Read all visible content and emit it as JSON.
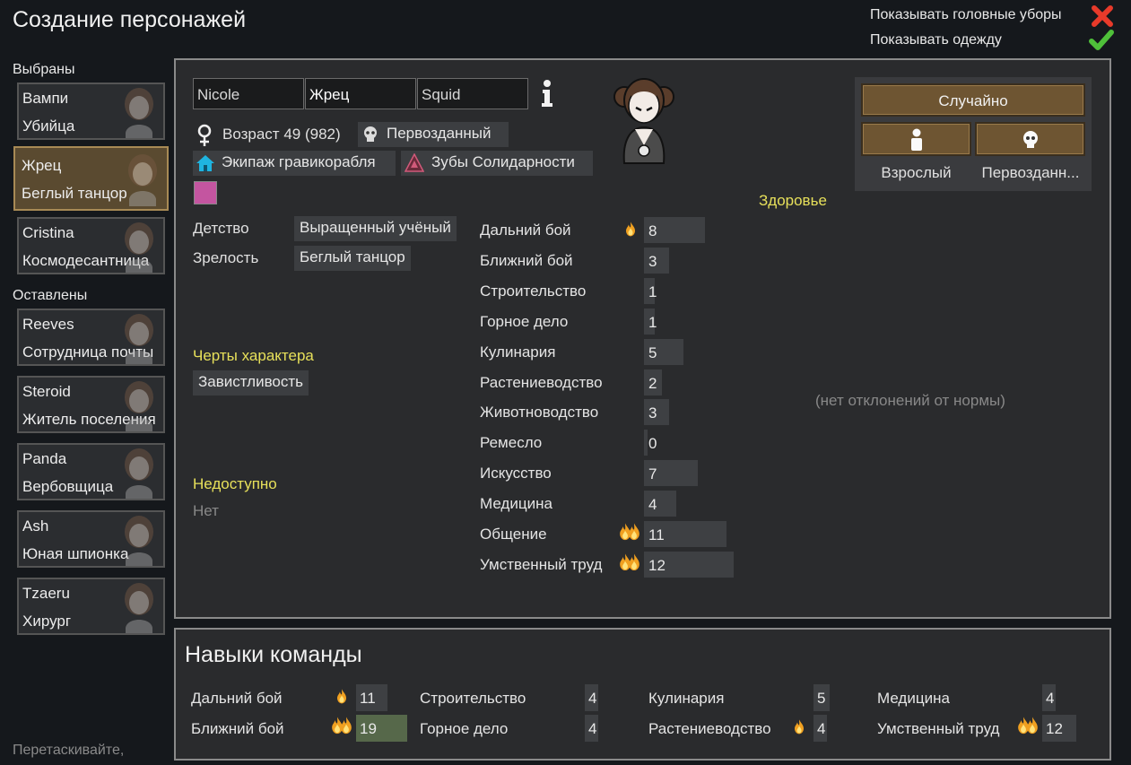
{
  "title": "Создание персонажей",
  "toggles": {
    "headgear": {
      "label": "Показывать головные уборы",
      "state": "off"
    },
    "clothes": {
      "label": "Показывать одежду",
      "state": "on"
    }
  },
  "selected_label": "Выбраны",
  "left_label": "Оставлены",
  "drag_hint": "Перетаскивайте,",
  "selected_pawns": [
    {
      "name": "Вампи",
      "job": "Убийца"
    },
    {
      "name": "Жрец",
      "job": "Беглый танцор"
    },
    {
      "name": "Cristina",
      "job": "Космодесантница"
    }
  ],
  "left_pawns": [
    {
      "name": "Reeves",
      "job": "Сотрудница почты"
    },
    {
      "name": "Steroid",
      "job": "Житель поселения"
    },
    {
      "name": "Panda",
      "job": "Вербовщица"
    },
    {
      "name": "Ash",
      "job": "Юная шпионка"
    },
    {
      "name": "Tzaeru",
      "job": "Хирург"
    }
  ],
  "pawn": {
    "first": "Nicole",
    "nick": "Жрец",
    "last": "Squid",
    "info_icon": "info-icon",
    "gender_icon": "female-icon",
    "age": "Возраст 49 (982)",
    "xenotype": "Первозданный",
    "faction": "Экипаж гравикорабля",
    "ideo": "Зубы Солидарности",
    "color": "#c455a0"
  },
  "backstory": {
    "childhood_label": "Детство",
    "childhood": "Выращенный учёный",
    "adulthood_label": "Зрелость",
    "adulthood": "Беглый танцор"
  },
  "traits": {
    "header": "Черты характера",
    "items": [
      "Завистливость"
    ]
  },
  "incapable": {
    "header": "Недоступно",
    "value": "Нет"
  },
  "skills": [
    {
      "name": "Дальний бой",
      "level": 8,
      "passion": 1
    },
    {
      "name": "Ближний бой",
      "level": 3,
      "passion": 0
    },
    {
      "name": "Строительство",
      "level": 1,
      "passion": 0
    },
    {
      "name": "Горное дело",
      "level": 1,
      "passion": 0
    },
    {
      "name": "Кулинария",
      "level": 5,
      "passion": 0
    },
    {
      "name": "Растениеводство",
      "level": 2,
      "passion": 0
    },
    {
      "name": "Животноводство",
      "level": 3,
      "passion": 0
    },
    {
      "name": "Ремесло",
      "level": 0,
      "passion": 0
    },
    {
      "name": "Искусство",
      "level": 7,
      "passion": 0
    },
    {
      "name": "Медицина",
      "level": 4,
      "passion": 0
    },
    {
      "name": "Общение",
      "level": 11,
      "passion": 2
    },
    {
      "name": "Умственный труд",
      "level": 12,
      "passion": 2
    }
  ],
  "random_panel": {
    "random_label": "Случайно",
    "dev_stage_label": "Взрослый",
    "xeno_label": "Первозданн..."
  },
  "health": {
    "header": "Здоровье",
    "status": "(нет отклонений от нормы)"
  },
  "team": {
    "header": "Навыки команды",
    "skills": [
      {
        "name": "Дальний бой",
        "value": "11",
        "passion": 1
      },
      {
        "name": "Ближний бой",
        "value": "19",
        "passion": 2
      },
      {
        "name": "Строительство",
        "value": "4",
        "passion": 0
      },
      {
        "name": "Горное дело",
        "value": "4",
        "passion": 0
      },
      {
        "name": "Кулинария",
        "value": "5",
        "passion": 0
      },
      {
        "name": "Растениеводство",
        "value": "4",
        "passion": 1
      },
      {
        "name": "Медицина",
        "value": "4",
        "passion": 0
      },
      {
        "name": "Умственный труд",
        "value": "12",
        "passion": 2
      }
    ]
  }
}
